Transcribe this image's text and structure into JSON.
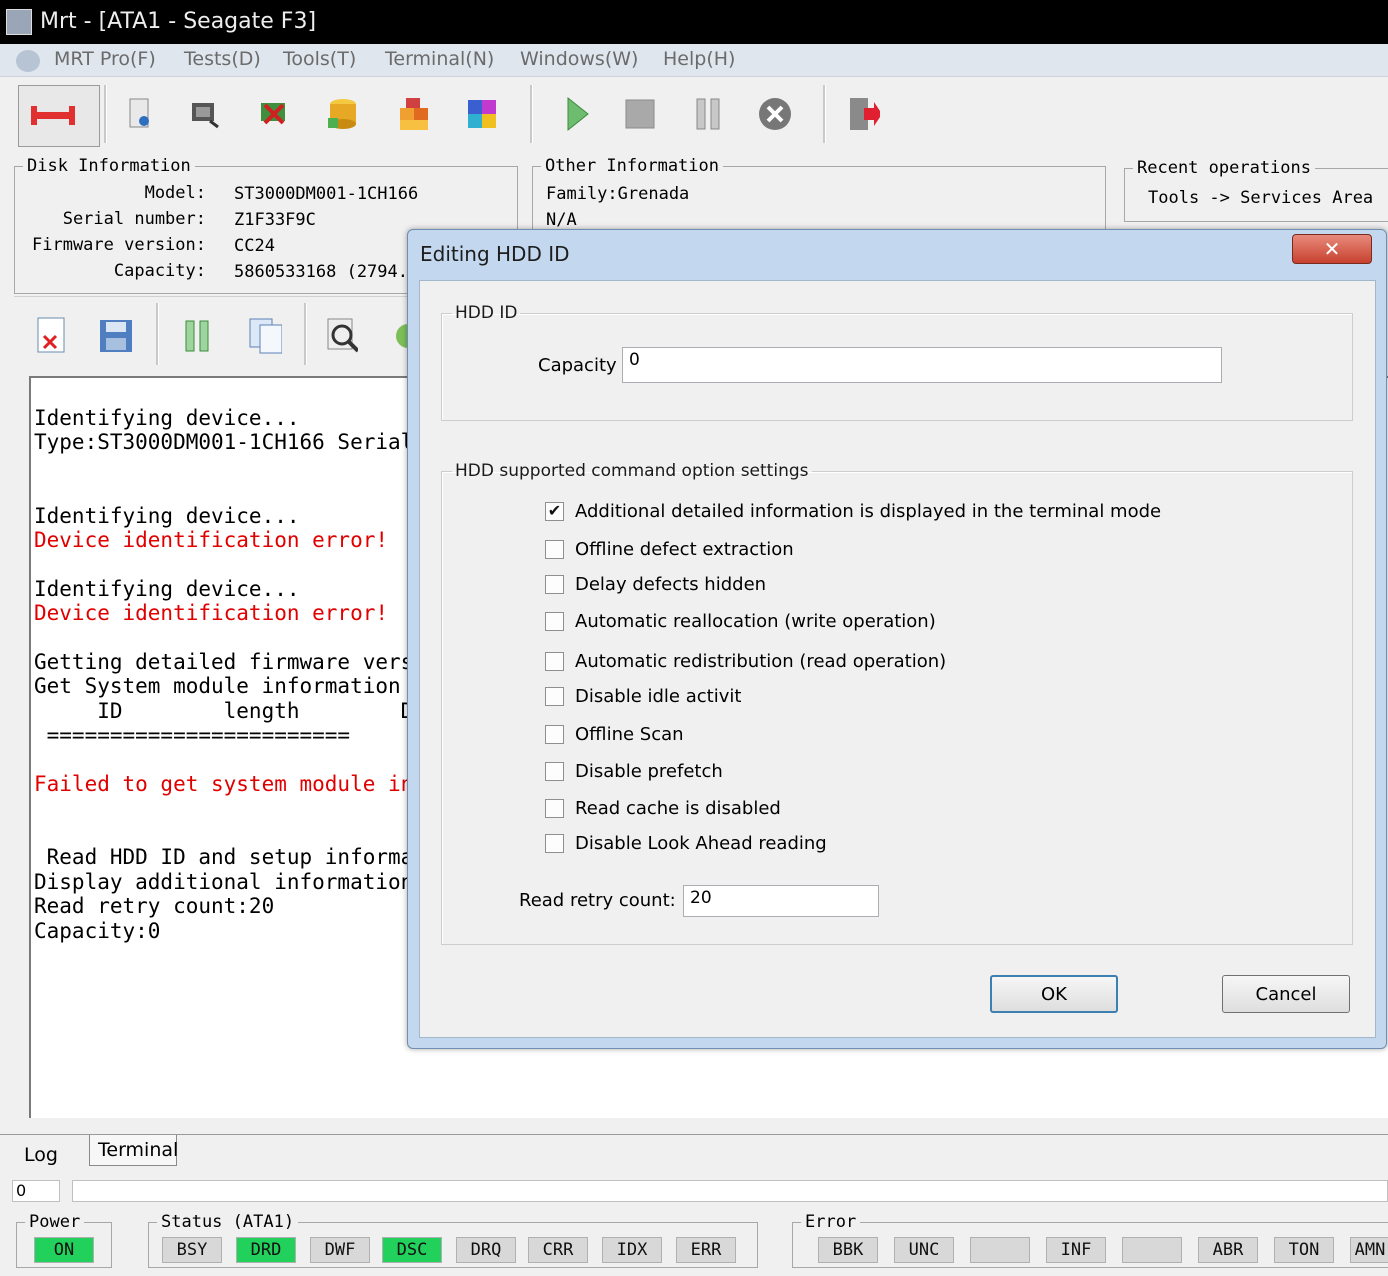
{
  "window": {
    "title": "Mrt - [ATA1 - Seagate F3]"
  },
  "menu": [
    "MRT Pro(F)",
    "Tests(D)",
    "Tools(T)",
    "Terminal(N)",
    "Windows(W)",
    "Help(H)"
  ],
  "toolbar": {
    "icons": [
      "disconnect-icon",
      "drive-info-icon",
      "tool-1-icon",
      "tool-2-icon",
      "database-icon",
      "blocks-icon",
      "modules-icon",
      "play-icon",
      "stop-icon",
      "pause-icon",
      "cancel-icon",
      "exit-icon"
    ]
  },
  "disk_info": {
    "legend": "Disk Information",
    "model_label": "Model:",
    "model": "ST3000DM001-1CH166",
    "serial_label": "Serial number:",
    "serial": "Z1F33F9C",
    "firmware_label": "Firmware version:",
    "firmware": "CC24",
    "capacity_label": "Capacity:",
    "capacity": "5860533168 (2794."
  },
  "other_info": {
    "legend": "Other Information",
    "family": "Family:Grenada",
    "line2": "N/A"
  },
  "recent": {
    "legend": "Recent operations",
    "item": "Tools -> Services Area"
  },
  "log_toolbar": {
    "icons": [
      "delete-log-icon",
      "save-icon",
      "pause-log-icon",
      "copy-icon",
      "search-icon",
      "refresh-icon"
    ]
  },
  "log": [
    {
      "text": "Identifying device...",
      "error": false
    },
    {
      "text": "Type:ST3000DM001-1CH166 Serial",
      "error": false
    },
    {
      "text": "Identifying device...",
      "error": false
    },
    {
      "text": "Device identification error!",
      "error": true
    },
    {
      "text": "Identifying device...",
      "error": false
    },
    {
      "text": "Device identification error!",
      "error": true
    },
    {
      "text": "Getting detailed firmware versi",
      "error": false
    },
    {
      "text": "Get System module information .",
      "error": false
    },
    {
      "text": "     ID        length        De",
      "error": false
    },
    {
      "text": " ========================",
      "error": false
    },
    {
      "text": "Failed to get system module inf",
      "error": true
    },
    {
      "text": " Read HDD ID and setup informat",
      "error": false
    },
    {
      "text": "Display additional information",
      "error": false
    },
    {
      "text": "Read retry count:20",
      "error": false
    },
    {
      "text": "Capacity:0",
      "error": false
    }
  ],
  "tabs": {
    "log": "Log",
    "terminal": "Terminal"
  },
  "progress": {
    "value_text": "0"
  },
  "power": {
    "legend": "Power",
    "led": "ON"
  },
  "status": {
    "legend": "Status (ATA1)",
    "leds": [
      {
        "label": "BSY",
        "on": false
      },
      {
        "label": "DRD",
        "on": true
      },
      {
        "label": "DWF",
        "on": false
      },
      {
        "label": "DSC",
        "on": true
      },
      {
        "label": "DRQ",
        "on": false
      },
      {
        "label": "CRR",
        "on": false
      },
      {
        "label": "IDX",
        "on": false
      },
      {
        "label": "ERR",
        "on": false
      }
    ]
  },
  "error_leds": {
    "legend": "Error",
    "leds": [
      "BBK",
      "UNC",
      "",
      "INF",
      "",
      "ABR",
      "TON",
      "AMN"
    ]
  },
  "dialog": {
    "title": "Editing HDD ID",
    "close": "✕",
    "hdd_id_legend": "HDD ID",
    "capacity_label": "Capacity",
    "capacity_value": "0",
    "options_legend": "HDD supported command option settings",
    "options": [
      {
        "label": "Additional detailed information is displayed in the terminal mode",
        "checked": true
      },
      {
        "label": "Offline defect extraction",
        "checked": false
      },
      {
        "label": "Delay defects hidden",
        "checked": false
      },
      {
        "label": "Automatic reallocation (write operation)",
        "checked": false
      },
      {
        "label": "Automatic redistribution (read operation)",
        "checked": false
      },
      {
        "label": "Disable idle activit",
        "checked": false
      },
      {
        "label": "Offline Scan",
        "checked": false
      },
      {
        "label": "Disable prefetch",
        "checked": false
      },
      {
        "label": "Read cache is disabled",
        "checked": false
      },
      {
        "label": "Disable Look Ahead reading",
        "checked": false
      }
    ],
    "retry_label": "Read retry count:",
    "retry_value": "20",
    "ok": "OK",
    "cancel": "Cancel"
  }
}
